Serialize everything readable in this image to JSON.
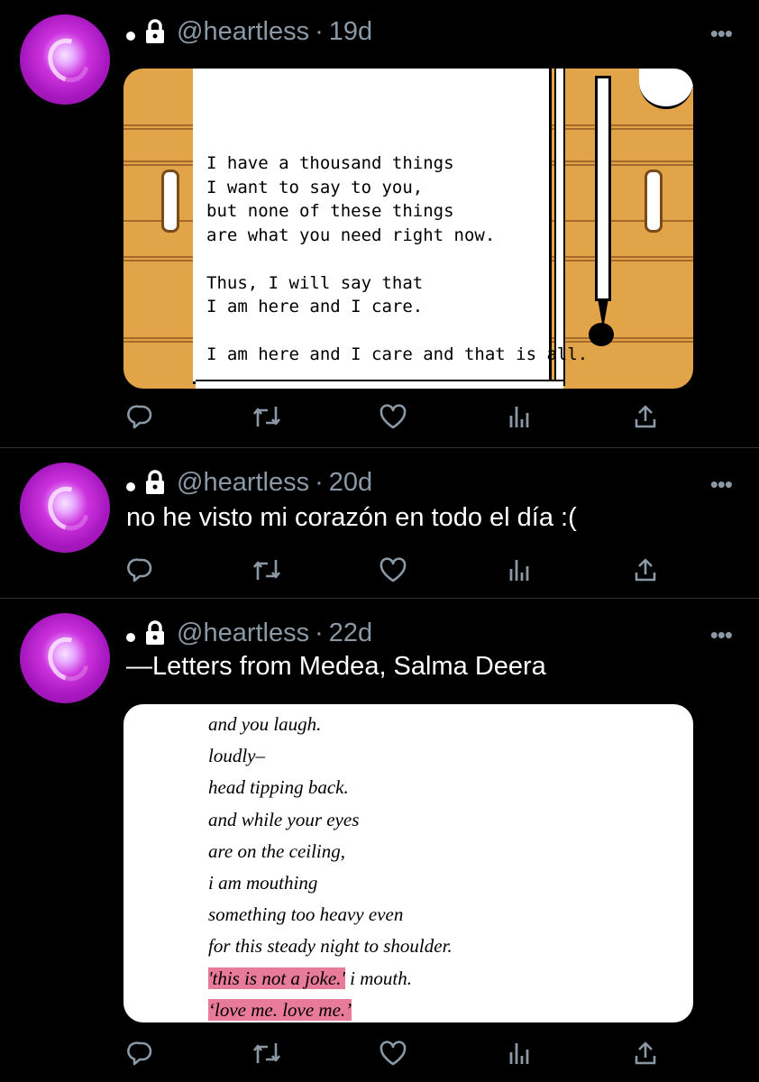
{
  "tweets": [
    {
      "handle": "@heartless",
      "separator": "·",
      "age": "19d",
      "text": "",
      "media": {
        "kind": "pixel-letter",
        "lines": [
          "I have a thousand things",
          "I want to say to you,",
          "but none of these things",
          "are what you need right now.",
          "",
          "Thus, I will say that",
          "I am here and I care.",
          "",
          "I am here and I care and that is all."
        ]
      }
    },
    {
      "handle": "@heartless",
      "separator": "·",
      "age": "20d",
      "text": "no he visto mi corazón en todo el día :("
    },
    {
      "handle": "@heartless",
      "separator": "·",
      "age": "22d",
      "text": "—Letters from Medea, Salma Deera",
      "media": {
        "kind": "book-page",
        "lines": [
          {
            "text": "and you laugh.",
            "highlight": ""
          },
          {
            "text": "loudly–",
            "highlight": ""
          },
          {
            "text": "head tipping back.",
            "highlight": ""
          },
          {
            "text": "and while your eyes",
            "highlight": ""
          },
          {
            "text": "are on the ceiling,",
            "highlight": ""
          },
          {
            "text": "i am mouthing",
            "highlight": ""
          },
          {
            "text": "something too heavy even",
            "highlight": ""
          },
          {
            "text": "for this steady night to shoulder.",
            "highlight": ""
          },
          {
            "text": " i mouth.",
            "highlight": "'this is not a joke.'"
          },
          {
            "text": "",
            "highlight": "‘love me. love me.’"
          }
        ]
      }
    }
  ],
  "icons": [
    "lock-icon",
    "more-icon",
    "reply-icon",
    "retweet-icon",
    "like-icon",
    "analytics-icon",
    "share-icon"
  ],
  "colors": {
    "background": "#000000",
    "secondary_text": "#8b98a5",
    "highlight": "#e87a9a",
    "wood": "#e2a448"
  }
}
